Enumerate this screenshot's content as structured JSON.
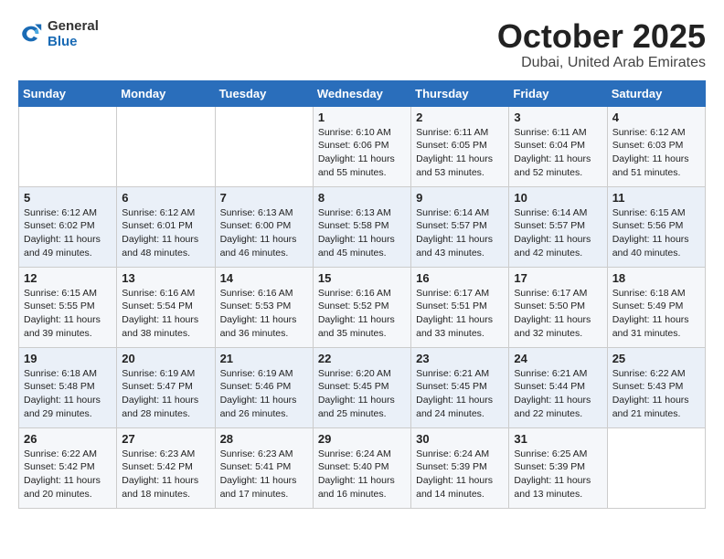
{
  "header": {
    "logo_general": "General",
    "logo_blue": "Blue",
    "month": "October 2025",
    "location": "Dubai, United Arab Emirates"
  },
  "weekdays": [
    "Sunday",
    "Monday",
    "Tuesday",
    "Wednesday",
    "Thursday",
    "Friday",
    "Saturday"
  ],
  "weeks": [
    [
      {
        "day": "",
        "info": ""
      },
      {
        "day": "",
        "info": ""
      },
      {
        "day": "",
        "info": ""
      },
      {
        "day": "1",
        "info": "Sunrise: 6:10 AM\nSunset: 6:06 PM\nDaylight: 11 hours\nand 55 minutes."
      },
      {
        "day": "2",
        "info": "Sunrise: 6:11 AM\nSunset: 6:05 PM\nDaylight: 11 hours\nand 53 minutes."
      },
      {
        "day": "3",
        "info": "Sunrise: 6:11 AM\nSunset: 6:04 PM\nDaylight: 11 hours\nand 52 minutes."
      },
      {
        "day": "4",
        "info": "Sunrise: 6:12 AM\nSunset: 6:03 PM\nDaylight: 11 hours\nand 51 minutes."
      }
    ],
    [
      {
        "day": "5",
        "info": "Sunrise: 6:12 AM\nSunset: 6:02 PM\nDaylight: 11 hours\nand 49 minutes."
      },
      {
        "day": "6",
        "info": "Sunrise: 6:12 AM\nSunset: 6:01 PM\nDaylight: 11 hours\nand 48 minutes."
      },
      {
        "day": "7",
        "info": "Sunrise: 6:13 AM\nSunset: 6:00 PM\nDaylight: 11 hours\nand 46 minutes."
      },
      {
        "day": "8",
        "info": "Sunrise: 6:13 AM\nSunset: 5:58 PM\nDaylight: 11 hours\nand 45 minutes."
      },
      {
        "day": "9",
        "info": "Sunrise: 6:14 AM\nSunset: 5:57 PM\nDaylight: 11 hours\nand 43 minutes."
      },
      {
        "day": "10",
        "info": "Sunrise: 6:14 AM\nSunset: 5:57 PM\nDaylight: 11 hours\nand 42 minutes."
      },
      {
        "day": "11",
        "info": "Sunrise: 6:15 AM\nSunset: 5:56 PM\nDaylight: 11 hours\nand 40 minutes."
      }
    ],
    [
      {
        "day": "12",
        "info": "Sunrise: 6:15 AM\nSunset: 5:55 PM\nDaylight: 11 hours\nand 39 minutes."
      },
      {
        "day": "13",
        "info": "Sunrise: 6:16 AM\nSunset: 5:54 PM\nDaylight: 11 hours\nand 38 minutes."
      },
      {
        "day": "14",
        "info": "Sunrise: 6:16 AM\nSunset: 5:53 PM\nDaylight: 11 hours\nand 36 minutes."
      },
      {
        "day": "15",
        "info": "Sunrise: 6:16 AM\nSunset: 5:52 PM\nDaylight: 11 hours\nand 35 minutes."
      },
      {
        "day": "16",
        "info": "Sunrise: 6:17 AM\nSunset: 5:51 PM\nDaylight: 11 hours\nand 33 minutes."
      },
      {
        "day": "17",
        "info": "Sunrise: 6:17 AM\nSunset: 5:50 PM\nDaylight: 11 hours\nand 32 minutes."
      },
      {
        "day": "18",
        "info": "Sunrise: 6:18 AM\nSunset: 5:49 PM\nDaylight: 11 hours\nand 31 minutes."
      }
    ],
    [
      {
        "day": "19",
        "info": "Sunrise: 6:18 AM\nSunset: 5:48 PM\nDaylight: 11 hours\nand 29 minutes."
      },
      {
        "day": "20",
        "info": "Sunrise: 6:19 AM\nSunset: 5:47 PM\nDaylight: 11 hours\nand 28 minutes."
      },
      {
        "day": "21",
        "info": "Sunrise: 6:19 AM\nSunset: 5:46 PM\nDaylight: 11 hours\nand 26 minutes."
      },
      {
        "day": "22",
        "info": "Sunrise: 6:20 AM\nSunset: 5:45 PM\nDaylight: 11 hours\nand 25 minutes."
      },
      {
        "day": "23",
        "info": "Sunrise: 6:21 AM\nSunset: 5:45 PM\nDaylight: 11 hours\nand 24 minutes."
      },
      {
        "day": "24",
        "info": "Sunrise: 6:21 AM\nSunset: 5:44 PM\nDaylight: 11 hours\nand 22 minutes."
      },
      {
        "day": "25",
        "info": "Sunrise: 6:22 AM\nSunset: 5:43 PM\nDaylight: 11 hours\nand 21 minutes."
      }
    ],
    [
      {
        "day": "26",
        "info": "Sunrise: 6:22 AM\nSunset: 5:42 PM\nDaylight: 11 hours\nand 20 minutes."
      },
      {
        "day": "27",
        "info": "Sunrise: 6:23 AM\nSunset: 5:42 PM\nDaylight: 11 hours\nand 18 minutes."
      },
      {
        "day": "28",
        "info": "Sunrise: 6:23 AM\nSunset: 5:41 PM\nDaylight: 11 hours\nand 17 minutes."
      },
      {
        "day": "29",
        "info": "Sunrise: 6:24 AM\nSunset: 5:40 PM\nDaylight: 11 hours\nand 16 minutes."
      },
      {
        "day": "30",
        "info": "Sunrise: 6:24 AM\nSunset: 5:39 PM\nDaylight: 11 hours\nand 14 minutes."
      },
      {
        "day": "31",
        "info": "Sunrise: 6:25 AM\nSunset: 5:39 PM\nDaylight: 11 hours\nand 13 minutes."
      },
      {
        "day": "",
        "info": ""
      }
    ]
  ]
}
